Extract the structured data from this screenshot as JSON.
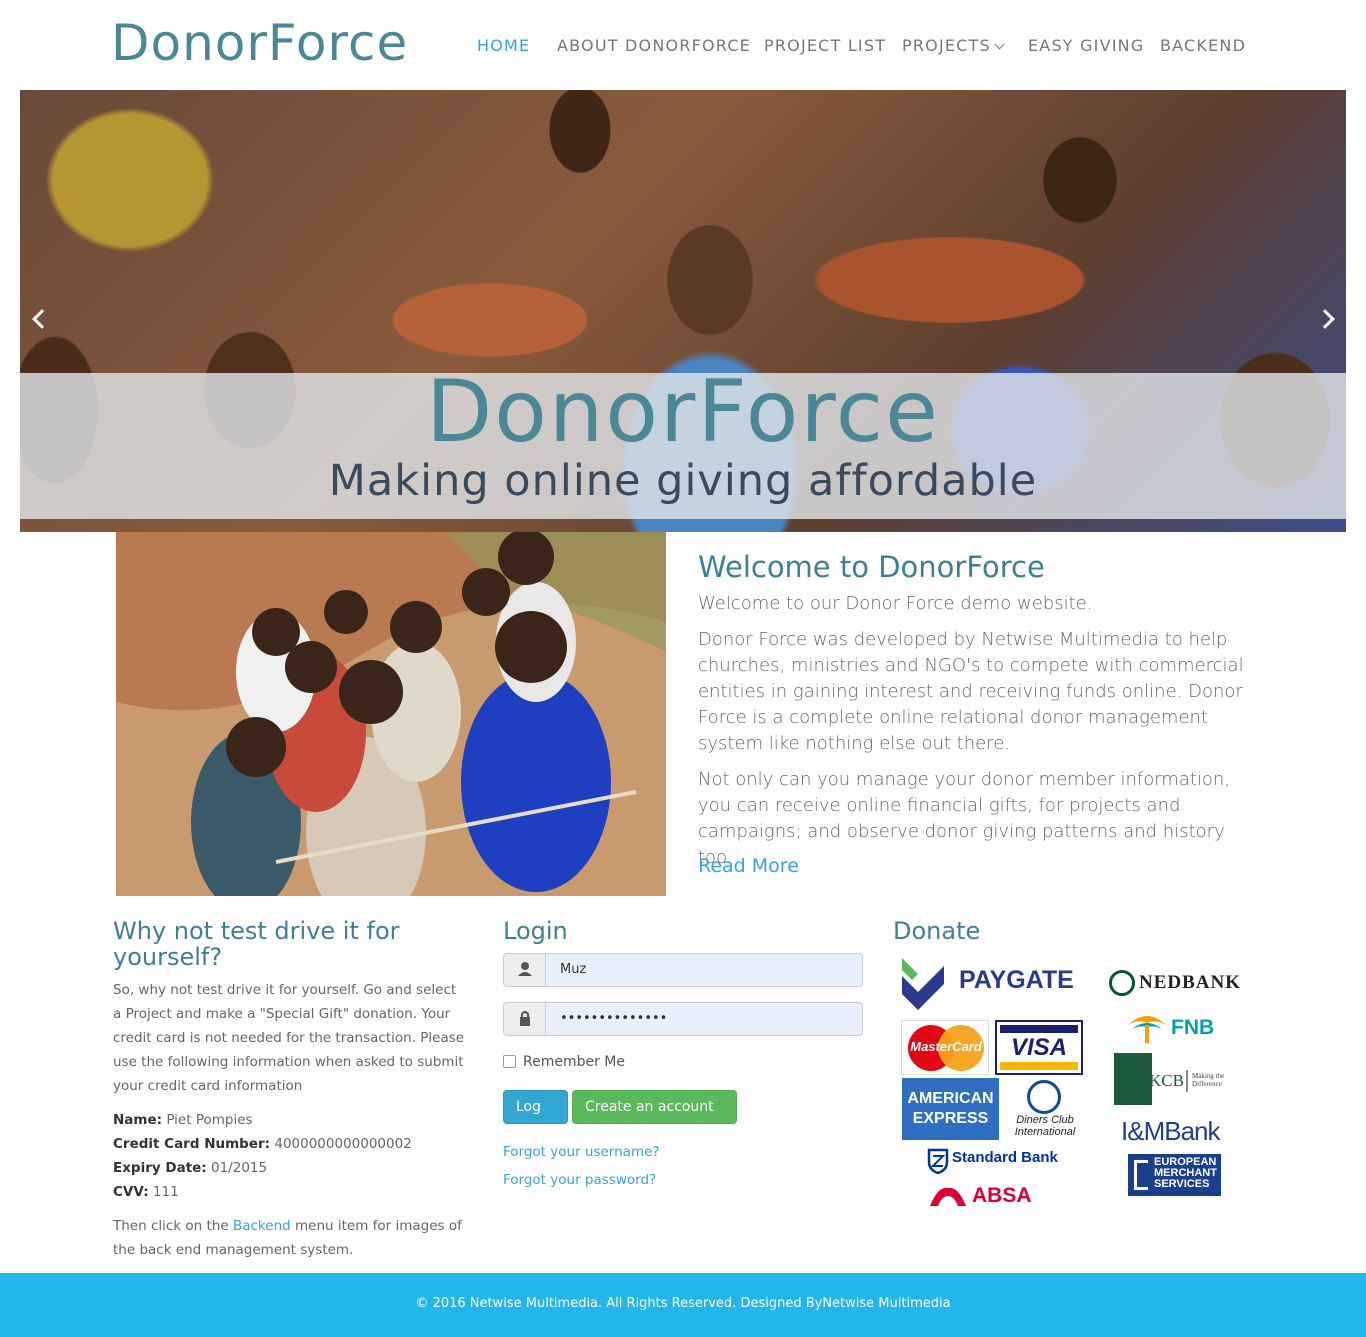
{
  "brand": "DonorForce",
  "nav": [
    {
      "label": "HOME",
      "active": true
    },
    {
      "label": "ABOUT DONORFORCE"
    },
    {
      "label": "PROJECT LIST"
    },
    {
      "label": "PROJECTS",
      "has_dropdown": true
    },
    {
      "label": "EASY GIVING"
    },
    {
      "label": "BACKEND"
    }
  ],
  "hero": {
    "title": "DonorForce",
    "subtitle": "Making online giving affordable"
  },
  "welcome": {
    "title": "Welcome to DonorForce",
    "p1": "Welcome to our Donor Force demo website.",
    "p2": "Donor Force was developed by Netwise Multimedia to help churches, ministries and NGO's to compete with commercial entities in gaining interest and receiving funds online. Donor Force is a complete online relational donor management system like nothing else out there.",
    "p3": "Not only can you manage your donor member information, you can receive online financial gifts, for projects and campaigns; and observe donor giving patterns and history too.",
    "read_more": "Read More"
  },
  "test_drive": {
    "title": "Why not test drive it for yourself?",
    "intro": "So, why not test drive it for yourself. Go and select a Project and make a \"Special Gift\" donation. Your credit card is not needed for the transaction. Please use the following information when asked to submit your credit card information",
    "name_label": "Name:",
    "name_value": "Piet Pompies",
    "cc_label": "Credit Card Number:",
    "cc_value": "4000000000000002",
    "expiry_label": "Expiry Date:",
    "expiry_value": "01/2015",
    "cvv_label": "CVV:",
    "cvv_value": "111",
    "outro_before": "Then click on the ",
    "outro_link": "Backend",
    "outro_after": " menu item for images of the back end management system."
  },
  "login": {
    "title": "Login",
    "username_value": "Muz",
    "password_value": "••••••••••••••",
    "remember": "Remember Me",
    "login_button": "Log in",
    "create_button": "Create an account",
    "forgot_username": "Forgot your username?",
    "forgot_password": "Forgot your password?"
  },
  "donate": {
    "title": "Donate",
    "logos": {
      "paygate": "PAYGATE",
      "mastercard": "MasterCard",
      "visa": "VISA",
      "amex_1": "AMERICAN",
      "amex_2": "EXPRESS",
      "diners_1": "Diners Club",
      "diners_2": "International",
      "standard_bank": "Standard Bank",
      "absa": "ABSA",
      "nedbank": "NEDBANK",
      "fnb": "FNB",
      "kcb": "KCB",
      "kcb_tag": "Making the Difference",
      "im_bank": "I&MBank",
      "emp_1": "EUROPEAN",
      "emp_2": "MERCHANT",
      "emp_3": "SERVICES"
    }
  },
  "footer": "© 2016 Netwise Multimedia. All Rights Reserved. Designed ByNetwise Multimedia"
}
